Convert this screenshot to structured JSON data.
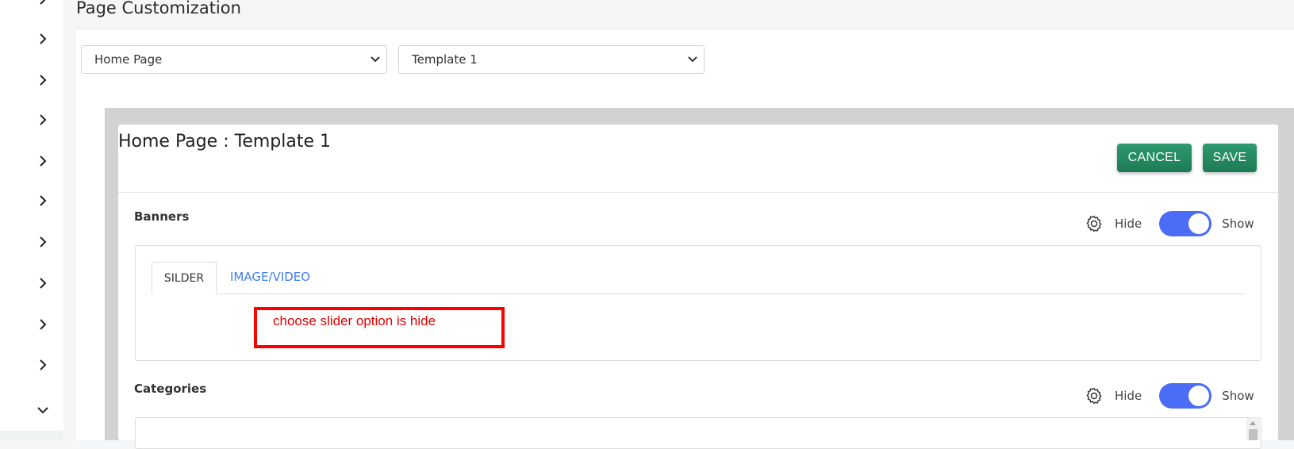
{
  "page": {
    "title": "Page Customization"
  },
  "filters": {
    "page_select": {
      "value": "Home Page"
    },
    "template_select": {
      "value": "Template 1"
    }
  },
  "editor": {
    "title": "Home Page : Template 1",
    "cancel_label": "CANCEL",
    "save_label": "SAVE"
  },
  "sections": {
    "banners": {
      "label": "Banners",
      "hide_label": "Hide",
      "show_label": "Show",
      "visible": true,
      "tabs": [
        "SILDER",
        "IMAGE/VIDEO"
      ],
      "active_tab": "SILDER"
    },
    "categories": {
      "label": "Categories",
      "hide_label": "Hide",
      "show_label": "Show",
      "visible": true
    }
  },
  "annotation": {
    "text": "choose slider option is hide",
    "color": "#ff0000"
  },
  "colors": {
    "button_green": "#1d7a55",
    "toggle_blue": "#4a6cf7",
    "tab_link_blue": "#3f7ef0"
  }
}
